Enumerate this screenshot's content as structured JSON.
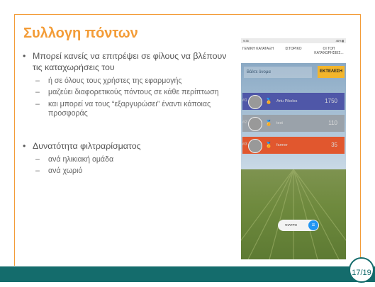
{
  "slide": {
    "title": "Συλλογη πόντων",
    "bullets": [
      "Μπορεί κανείς να επιτρέψει σε φίλους να βλέπουν τις καταχωρήσεις του",
      "Δυνατότητα φιλτραρίσματος"
    ],
    "sub1": [
      "ή σε  όλους τους χρήστες της εφαρμογής",
      "μαζεύει διαφορετικούς πόντους σε κάθε περίπτωση",
      "και μπορεί να τους “εξαργυρώσει” έναντι κάποιας προσφοράς"
    ],
    "sub2": [
      "ανά ηλικιακή ομάδα",
      "ανά χωριό"
    ],
    "page_number": "17/19"
  },
  "app": {
    "status_time": "9:35",
    "status_right": "46% ▮",
    "tabs": [
      "ΓΕΝΙΚΗ ΚΑΤΑΤΑΞΗ",
      "ΙΣΤΟΡΙΚΟ",
      "ΟΙ ΤΟΠ ΚΑΤΑΧΩΡΗΣΕΙΣ..."
    ],
    "search_placeholder": "Βάλτε όνομα",
    "run_label": "ΕΚΤΕΛΕΣΗ",
    "rows": [
      {
        "rank": "#1",
        "name": "Artu Pikolos",
        "points": "1750"
      },
      {
        "rank": "#2",
        "name": "test",
        "points": "110"
      },
      {
        "rank": "#3",
        "name": "farmer",
        "points": "35"
      }
    ],
    "filter_label": "ΦΙΛΤΡΟ"
  },
  "colors": {
    "accent": "#f39c37",
    "footer": "#146c6c",
    "run": "#f3b52b",
    "row1": "#4f57a8",
    "row2": "#9aa2aa",
    "row3": "#e1572e"
  }
}
